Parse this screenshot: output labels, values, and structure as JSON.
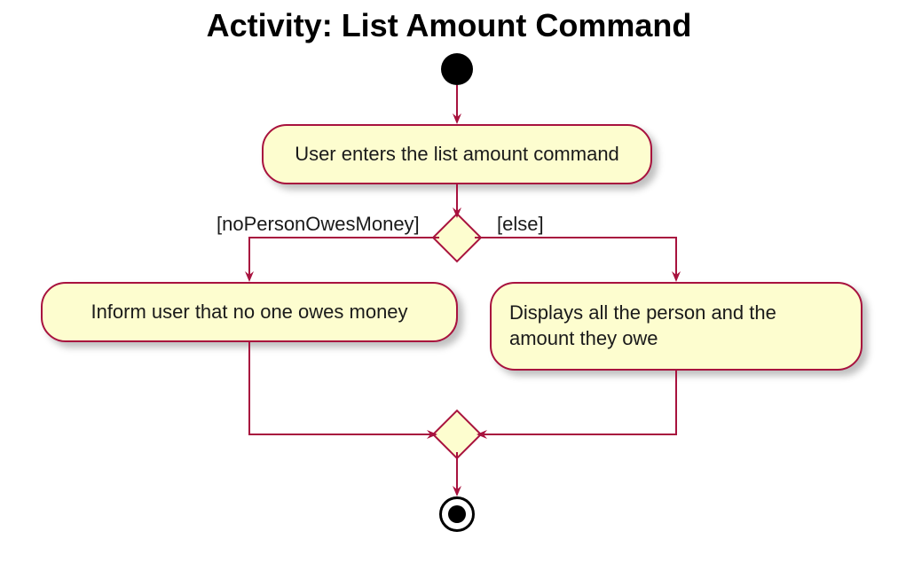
{
  "title": "Activity: List Amount Command",
  "activities": {
    "a1": "User enters the list amount command",
    "a2": "Inform user that no one owes money",
    "a3": "Displays all the person and the amount they owe"
  },
  "guards": {
    "left": "[noPersonOwesMoney]",
    "right": "[else]"
  },
  "chart_data": {
    "type": "uml-activity-diagram",
    "title": "Activity: List Amount Command",
    "nodes": [
      {
        "id": "start",
        "kind": "initial"
      },
      {
        "id": "A1",
        "kind": "action",
        "label": "User enters the list amount command"
      },
      {
        "id": "D1",
        "kind": "decision"
      },
      {
        "id": "A2",
        "kind": "action",
        "label": "Inform user that no one owes money"
      },
      {
        "id": "A3",
        "kind": "action",
        "label": "Displays all the person and the amount they owe"
      },
      {
        "id": "M1",
        "kind": "merge"
      },
      {
        "id": "end",
        "kind": "final"
      }
    ],
    "edges": [
      {
        "from": "start",
        "to": "A1"
      },
      {
        "from": "A1",
        "to": "D1"
      },
      {
        "from": "D1",
        "to": "A2",
        "guard": "[noPersonOwesMoney]"
      },
      {
        "from": "D1",
        "to": "A3",
        "guard": "[else]"
      },
      {
        "from": "A2",
        "to": "M1"
      },
      {
        "from": "A3",
        "to": "M1"
      },
      {
        "from": "M1",
        "to": "end"
      }
    ]
  }
}
